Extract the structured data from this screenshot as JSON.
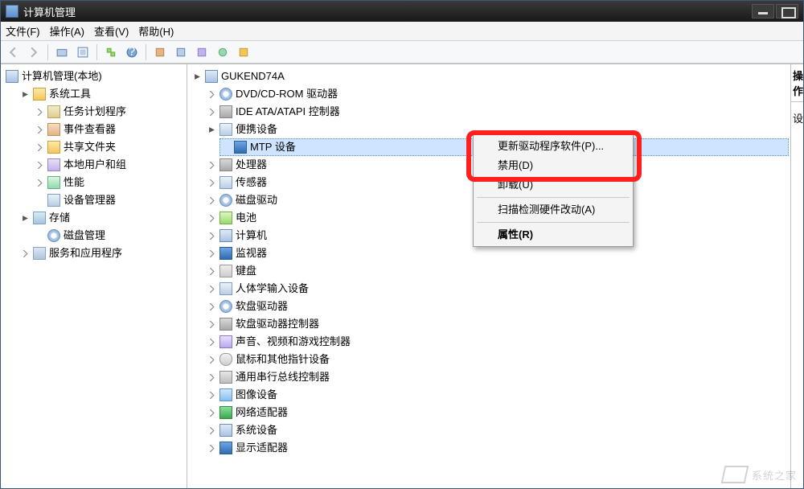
{
  "title": "计算机管理",
  "menu": {
    "file": "文件(F)",
    "action": "操作(A)",
    "view": "查看(V)",
    "help": "帮助(H)"
  },
  "right": {
    "header": "操作",
    "sub": "设"
  },
  "leftTree": {
    "root": "计算机管理(本地)",
    "sysTools": "系统工具",
    "schedTasks": "任务计划程序",
    "eventViewer": "事件查看器",
    "sharedFolders": "共享文件夹",
    "localUsers": "本地用户和组",
    "performance": "性能",
    "deviceManager": "设备管理器",
    "storage": "存储",
    "diskMgmt": "磁盘管理",
    "services": "服务和应用程序"
  },
  "devTree": {
    "host": "GUKEND74A",
    "dvd": "DVD/CD-ROM 驱动器",
    "ide": "IDE ATA/ATAPI 控制器",
    "portable": "便携设备",
    "mtp": "MTP 设备",
    "cpu": "处理器",
    "sensor": "传感器",
    "diskDrive": "磁盘驱动",
    "battery": "电池",
    "computer": "计算机",
    "monitor": "监视器",
    "keyboard": "键盘",
    "hid": "人体学输入设备",
    "floppy": "软盘驱动器",
    "floppyCtrl": "软盘驱动器控制器",
    "sound": "声音、视频和游戏控制器",
    "mouse": "鼠标和其他指针设备",
    "usb": "通用串行总线控制器",
    "imaging": "图像设备",
    "network": "网络适配器",
    "system": "系统设备",
    "display": "显示适配器"
  },
  "context": {
    "updateDriver": "更新驱动程序软件(P)...",
    "disable": "禁用(D)",
    "uninstall": "卸载(U)",
    "scan": "扫描检测硬件改动(A)",
    "properties": "属性(R)"
  },
  "watermark": "系统之家"
}
